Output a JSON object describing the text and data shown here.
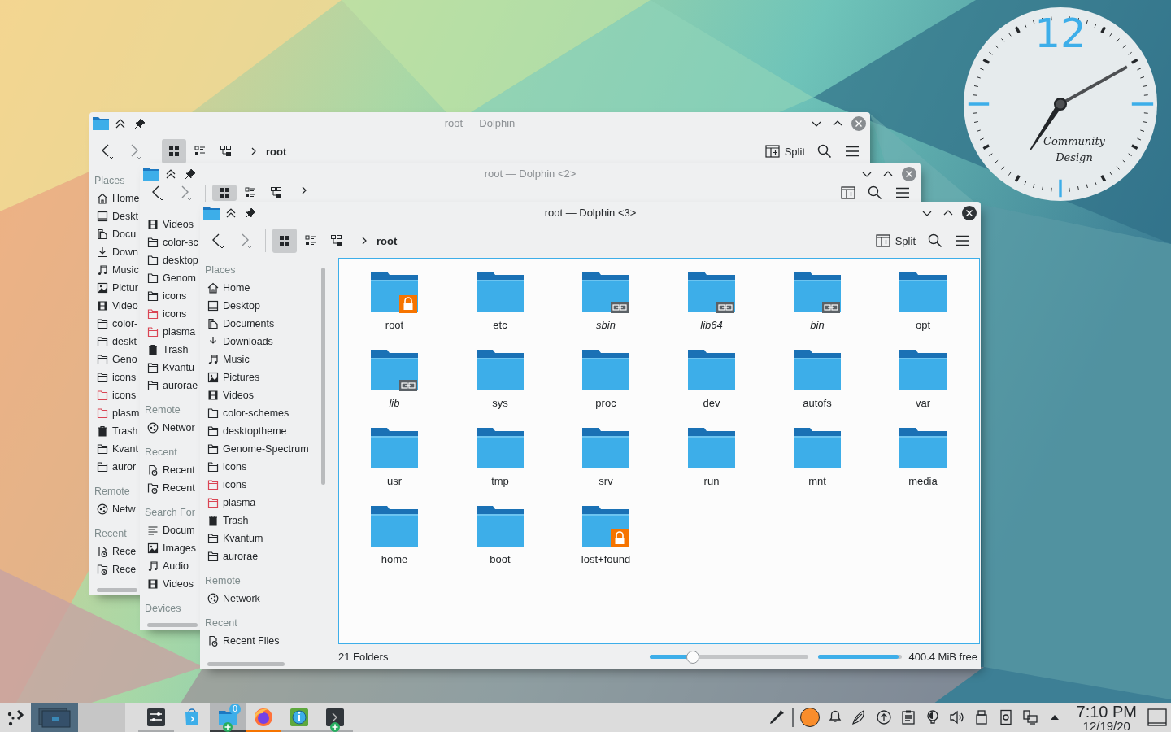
{
  "desktop_clock": {
    "numeral": "12",
    "caption": "Community Design"
  },
  "windows": [
    {
      "title": "root — Dolphin",
      "active": false,
      "breadcrumb": "root",
      "split_label": "Split",
      "views": [
        {
          "selected": true
        },
        {
          "selected": false
        },
        {
          "selected": false
        }
      ],
      "sidebar": [
        {
          "heading": "Places",
          "items": [
            {
              "label": "Home",
              "kind": "home"
            },
            {
              "label": "Deskt",
              "kind": "desktop"
            },
            {
              "label": "Docu",
              "kind": "documents"
            },
            {
              "label": "Down",
              "kind": "downloads"
            },
            {
              "label": "Music",
              "kind": "music"
            },
            {
              "label": "Pictur",
              "kind": "pictures"
            },
            {
              "label": "Video",
              "kind": "videos"
            },
            {
              "label": "color-",
              "kind": "folder"
            },
            {
              "label": "deskt",
              "kind": "folder"
            },
            {
              "label": "Geno",
              "kind": "folder"
            },
            {
              "label": "icons",
              "kind": "folder"
            },
            {
              "label": "icons",
              "kind": "folder",
              "color": "#da4453"
            },
            {
              "label": "plasm",
              "kind": "folder",
              "color": "#da4453"
            },
            {
              "label": "Trash",
              "kind": "trash"
            },
            {
              "label": "Kvant",
              "kind": "folder"
            },
            {
              "label": "auror",
              "kind": "folder"
            }
          ]
        },
        {
          "heading": "Remote",
          "items": [
            {
              "label": "Netw",
              "kind": "network"
            }
          ]
        },
        {
          "heading": "Recent",
          "items": [
            {
              "label": "Rece",
              "kind": "recent-files"
            },
            {
              "label": "Rece",
              "kind": "recent-locations"
            }
          ]
        }
      ]
    },
    {
      "title": "root — Dolphin <2>",
      "active": false,
      "views": [
        {
          "selected": true
        },
        {
          "selected": false
        },
        {
          "selected": false
        }
      ],
      "sidebar": [
        {
          "items": [
            {
              "label": "Videos",
              "kind": "videos"
            },
            {
              "label": "color-sc",
              "kind": "folder"
            },
            {
              "label": "desktop",
              "kind": "folder"
            },
            {
              "label": "Genom",
              "kind": "folder"
            },
            {
              "label": "icons",
              "kind": "folder"
            },
            {
              "label": "icons",
              "kind": "folder",
              "color": "#da4453"
            },
            {
              "label": "plasma",
              "kind": "folder",
              "color": "#da4453"
            },
            {
              "label": "Trash",
              "kind": "trash"
            },
            {
              "label": "Kvantu",
              "kind": "folder"
            },
            {
              "label": "aurorae",
              "kind": "folder"
            }
          ]
        },
        {
          "heading": "Remote",
          "items": [
            {
              "label": "Networ",
              "kind": "network"
            }
          ]
        },
        {
          "heading": "Recent",
          "items": [
            {
              "label": "Recent",
              "kind": "recent-files"
            },
            {
              "label": "Recent",
              "kind": "recent-locations"
            }
          ]
        },
        {
          "heading": "Search For",
          "items": [
            {
              "label": "Docum",
              "kind": "text"
            },
            {
              "label": "Images",
              "kind": "pictures"
            },
            {
              "label": "Audio",
              "kind": "music"
            },
            {
              "label": "Videos",
              "kind": "videos"
            }
          ]
        },
        {
          "heading": "Devices"
        }
      ]
    },
    {
      "title": "root — Dolphin <3>",
      "active": true,
      "breadcrumb": "root",
      "split_label": "Split",
      "views": [
        {
          "selected": true
        },
        {
          "selected": false
        },
        {
          "selected": false
        }
      ],
      "sidebar": [
        {
          "heading": "Places",
          "items": [
            {
              "label": "Home",
              "kind": "home"
            },
            {
              "label": "Desktop",
              "kind": "desktop"
            },
            {
              "label": "Documents",
              "kind": "documents"
            },
            {
              "label": "Downloads",
              "kind": "downloads"
            },
            {
              "label": "Music",
              "kind": "music"
            },
            {
              "label": "Pictures",
              "kind": "pictures"
            },
            {
              "label": "Videos",
              "kind": "videos"
            },
            {
              "label": "color-schemes",
              "kind": "folder"
            },
            {
              "label": "desktoptheme",
              "kind": "folder"
            },
            {
              "label": "Genome-Spectrum",
              "kind": "folder"
            },
            {
              "label": "icons",
              "kind": "folder"
            },
            {
              "label": "icons",
              "kind": "folder",
              "color": "#da4453"
            },
            {
              "label": "plasma",
              "kind": "folder",
              "color": "#da4453"
            },
            {
              "label": "Trash",
              "kind": "trash"
            },
            {
              "label": "Kvantum",
              "kind": "folder"
            },
            {
              "label": "aurorae",
              "kind": "folder"
            }
          ]
        },
        {
          "heading": "Remote",
          "items": [
            {
              "label": "Network",
              "kind": "network"
            }
          ]
        },
        {
          "heading": "Recent",
          "items": [
            {
              "label": "Recent Files",
              "kind": "recent-files"
            }
          ]
        }
      ],
      "folders": [
        {
          "name": "root",
          "symlink": false,
          "locked": true
        },
        {
          "name": "etc",
          "symlink": false,
          "locked": false
        },
        {
          "name": "sbin",
          "symlink": true,
          "locked": false
        },
        {
          "name": "lib64",
          "symlink": true,
          "locked": false
        },
        {
          "name": "bin",
          "symlink": true,
          "locked": false
        },
        {
          "name": "opt",
          "symlink": false,
          "locked": false
        },
        {
          "name": "lib",
          "symlink": true,
          "locked": false
        },
        {
          "name": "sys",
          "symlink": false,
          "locked": false
        },
        {
          "name": "proc",
          "symlink": false,
          "locked": false
        },
        {
          "name": "dev",
          "symlink": false,
          "locked": false
        },
        {
          "name": "autofs",
          "symlink": false,
          "locked": false
        },
        {
          "name": "var",
          "symlink": false,
          "locked": false
        },
        {
          "name": "usr",
          "symlink": false,
          "locked": false
        },
        {
          "name": "tmp",
          "symlink": false,
          "locked": false
        },
        {
          "name": "srv",
          "symlink": false,
          "locked": false
        },
        {
          "name": "run",
          "symlink": false,
          "locked": false
        },
        {
          "name": "mnt",
          "symlink": false,
          "locked": false
        },
        {
          "name": "media",
          "symlink": false,
          "locked": false
        },
        {
          "name": "home",
          "symlink": false,
          "locked": false
        },
        {
          "name": "boot",
          "symlink": false,
          "locked": false
        },
        {
          "name": "lost+found",
          "symlink": false,
          "locked": true
        }
      ],
      "status": {
        "summary": "21 Folders",
        "zoom": {
          "level": 0.27
        },
        "free_space": {
          "level": 0.96,
          "reading": "400.4 MiB free"
        }
      }
    }
  ],
  "taskbar": {
    "pager": [
      {
        "selected": true
      },
      {
        "selected": false
      }
    ],
    "tasks": [
      {
        "kind": "settings",
        "open": true,
        "selected": false,
        "attention": false,
        "plus": false
      },
      {
        "kind": "discover",
        "open": false,
        "selected": false,
        "attention": false,
        "plus": false
      },
      {
        "kind": "file-manager",
        "open": true,
        "selected": true,
        "attention": false,
        "plus": true,
        "badge": "0"
      },
      {
        "kind": "browser",
        "open": true,
        "selected": false,
        "attention": true,
        "plus": false
      },
      {
        "kind": "info-center",
        "open": true,
        "selected": false,
        "attention": false,
        "plus": false
      },
      {
        "kind": "terminal",
        "open": true,
        "selected": false,
        "attention": false,
        "plus": true
      }
    ],
    "tray": [
      {
        "kind": "color-picker"
      },
      {
        "kind": "color-swatch",
        "color": "#f98d2b"
      },
      {
        "kind": "notifications"
      },
      {
        "kind": "kdeconnect"
      },
      {
        "kind": "updates"
      },
      {
        "kind": "clipboard"
      },
      {
        "kind": "night-color"
      },
      {
        "kind": "volume"
      },
      {
        "kind": "usb"
      },
      {
        "kind": "device"
      },
      {
        "kind": "network"
      },
      {
        "kind": "expand"
      }
    ],
    "clock": {
      "time": "7:10 PM",
      "date": "12/19/20"
    }
  }
}
